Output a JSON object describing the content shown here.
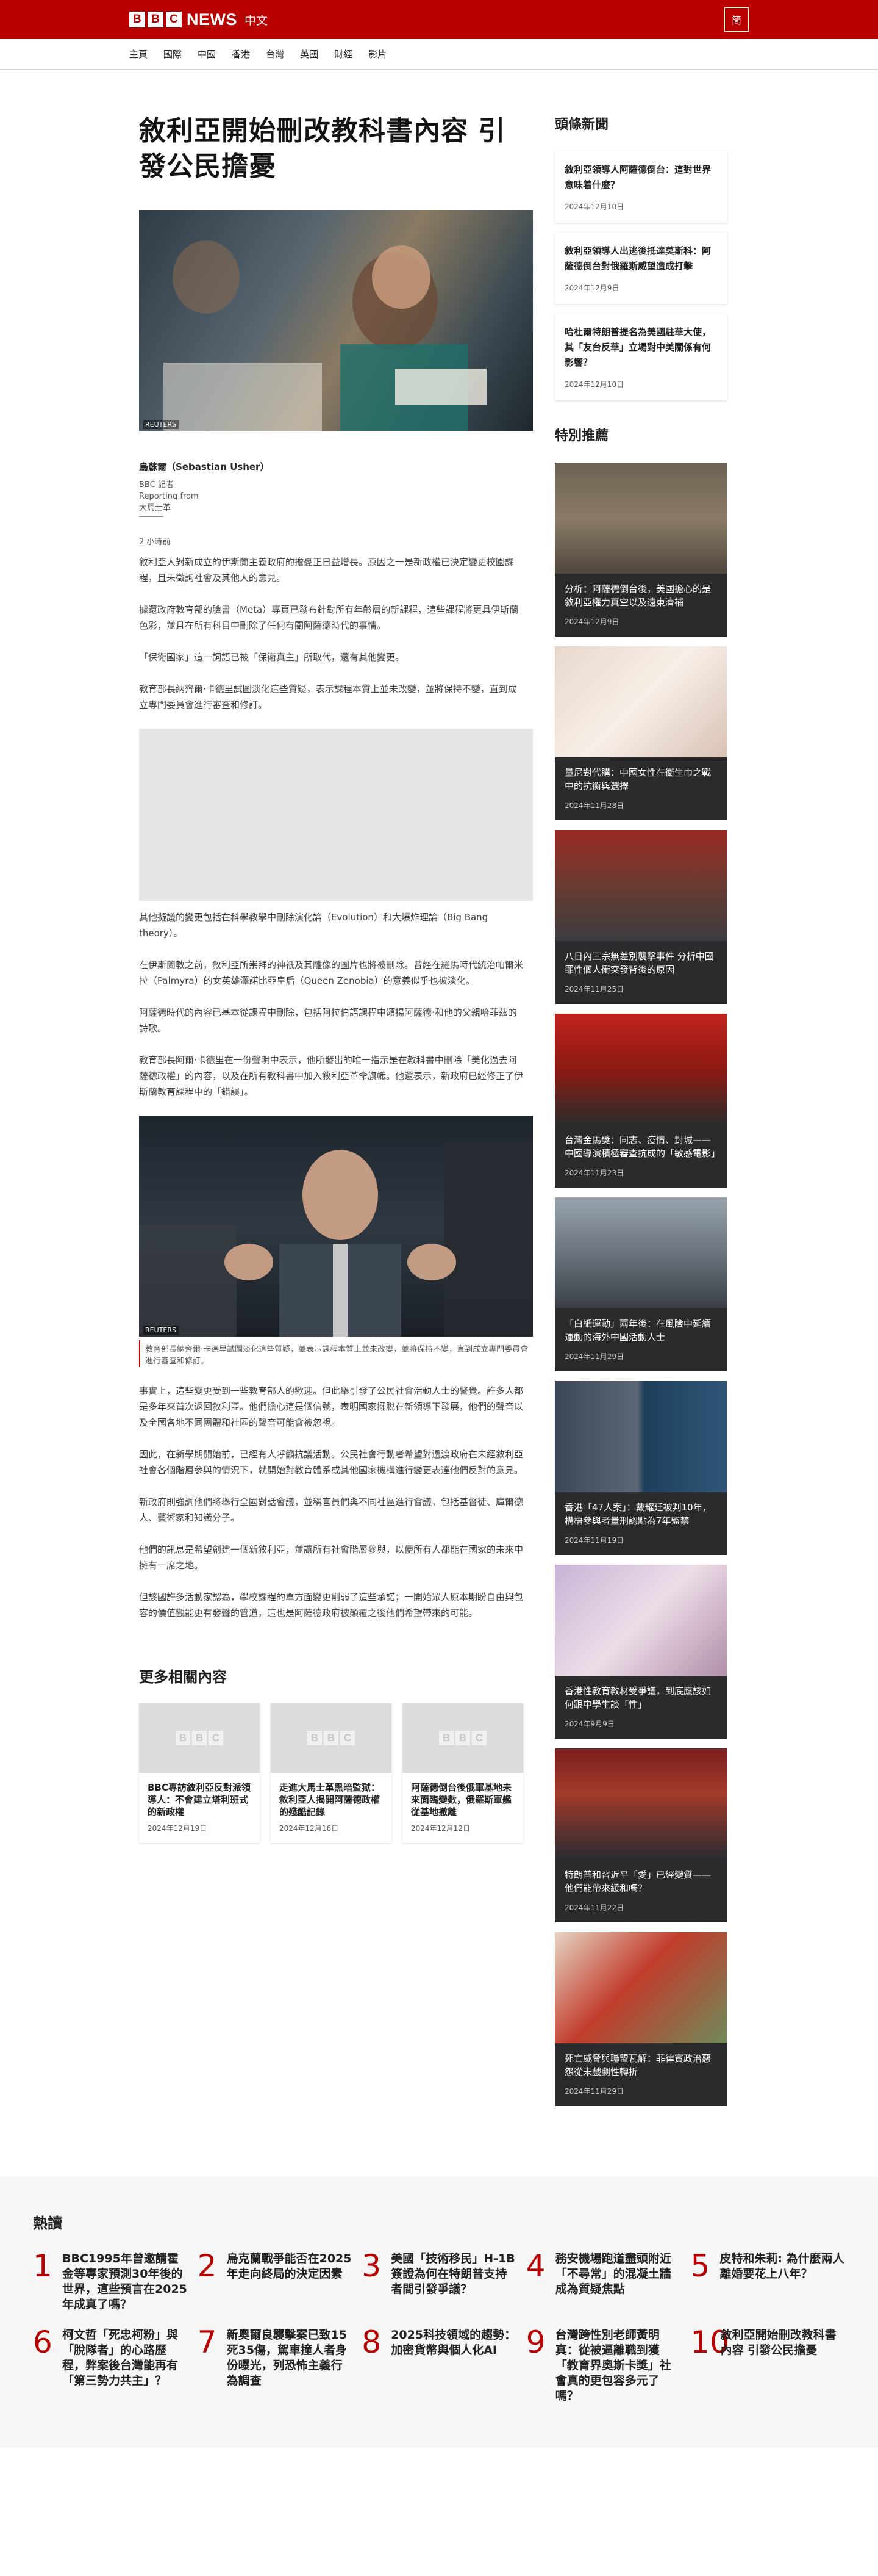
{
  "header": {
    "logo_letters": [
      "B",
      "B",
      "C"
    ],
    "news_word": "NEWS",
    "language": "中文",
    "script_toggle": "简"
  },
  "nav": {
    "items": [
      "主頁",
      "國際",
      "中國",
      "香港",
      "台灣",
      "英國",
      "財經",
      "影片"
    ]
  },
  "article": {
    "headline": "敘利亞開始刪改教科書內容 引發公民擔憂",
    "hero_credit": "REUTERS",
    "author_name": "烏蘇爾（Sebastian Usher）",
    "author_role1": "BBC 記者",
    "author_role2": "Reporting from",
    "author_location": "大馬士革",
    "timestamp": "2 小時前",
    "paragraphs_a": [
      "敘利亞人對新成立的伊斯蘭主義政府的擔憂正日益增長。原因之一是新政權已決定變更校園課程，且未徵詢社會及其他人的意見。",
      "據還政府教育部的臉書（Meta）專頁已發布針對所有年齡層的新課程，這些課程將更具伊斯蘭色彩，並且在所有科目中刪除了任何有關阿薩德時代的事情。",
      "「保衛國家」這一詞語已被「保衛真主」所取代，還有其他變更。",
      "教育部長納齊爾·卡德里試圖淡化這些質疑，表示課程本質上並未改變，並將保持不變，直到成立專門委員會進行審查和修訂。"
    ],
    "paragraphs_b": [
      "其他擬議的變更包括在科學教學中刪除演化論（Evolution）和大爆炸理論（Big Bang theory）。",
      "在伊斯蘭教之前，敘利亞所崇拜的神祇及其雕像的圖片也將被刪除。曾經在羅馬時代統治帕爾米拉（Palmyra）的女英雄澤諾比亞皇后（Queen Zenobia）的意義似乎也被淡化。",
      "阿薩德時代的內容已基本從課程中刪除，包括阿拉伯語課程中頌揚阿薩德·和他的父親哈菲茲的詩歌。",
      "教育部長阿爾·卡德里在一份聲明中表示，他所發出的唯一指示是在教科書中刪除「美化過去阿薩德政權」的內容，以及在所有教科書中加入敘利亞革命旗幟。他還表示，新政府已經修正了伊斯蘭教育課程中的「錯誤」。"
    ],
    "second_credit": "REUTERS",
    "second_caption": "教育部長納齊爾·卡德里試圖淡化這些質疑，並表示課程本質上並未改變，並將保持不變，直到成立專門委員會進行審查和修訂。",
    "paragraphs_c": [
      "事實上，這些變更受到一些教育部人的歡迎。但此舉引發了公民社會活動人士的警覺。許多人都是多年來首次返回敘利亞。他們擔心這是個信號，表明國家擺脫在新領導下發展，他們的聲音以及全國各地不同團體和社區的聲音可能會被忽視。",
      "因此，在新學期開始前，已經有人呼籲抗議活動。公民社會行動者希望對過渡政府在未經敘利亞社會各個階層參與的情況下，就開始對教育體系或其他國家機構進行變更表達他們反對的意見。",
      "新政府則強調他們將舉行全國對話會議，並稱官員們與不同社區進行會議，包括基督徒、庫爾德人、藝術家和知識分子。",
      "他們的訊息是希望創建一個新敘利亞，並讓所有社會階層參與，以便所有人都能在國家的未來中擁有一席之地。",
      "但該國許多活動家認為，學校課程的單方面變更削弱了這些承諾；一開始眾人原本期盼自由與包容的價值觀能更有發聲的管道，這也是阿薩德政府被顛覆之後他們希望帶來的可能。"
    ]
  },
  "related": {
    "title": "更多相關內容",
    "cards": [
      {
        "headline": "BBC專訪敘利亞反對派領導人：不會建立塔利班式的新政權",
        "date": "2024年12月19日"
      },
      {
        "headline": "走進大馬士革黑暗監獄：敘利亞人揭開阿薩德政權的殘酷記錄",
        "date": "2024年12月16日"
      },
      {
        "headline": "阿薩德倒台後俄軍基地未來面臨變數，俄羅斯軍艦從基地撤離",
        "date": "2024年12月12日"
      }
    ]
  },
  "sidebar": {
    "top_title": "頭條新聞",
    "top_stories": [
      {
        "headline": "敘利亞領導人阿薩德倒台：這對世界意味着什麼？",
        "date": "2024年12月10日"
      },
      {
        "headline": "敘利亞領導人出逃後抵達莫斯科：阿薩德倒台對俄羅斯威望造成打擊",
        "date": "2024年12月9日"
      },
      {
        "headline": "哈杜爾特朗普提名為美國駐華大使，其「友台反華」立場對中美關係有何影響？",
        "date": "2024年12月10日"
      }
    ],
    "featured_title": "特別推薦",
    "featured": [
      {
        "headline": "分析：阿薩德倒台後，美國擔心的是敘利亞權力真空以及遠東濟補",
        "date": "2024年12月9日"
      },
      {
        "headline": "量尼對代購：中國女性在衛生巾之戰中的抗衡與選擇",
        "date": "2024年11月28日"
      },
      {
        "headline": "八日內三宗無差別襲擊事件 分析中國罪性個人衝突發背後的原因",
        "date": "2024年11月25日"
      },
      {
        "headline": "台灣金馬獎：同志、疫情、封城——中國導演積極審查抗成的「敏感電影」",
        "date": "2024年11月23日"
      },
      {
        "headline": "「白紙運動」兩年後：在風險中延續運動的海外中國活動人士",
        "date": "2024年11月29日"
      },
      {
        "headline": "香港「47人案」：戴耀廷被判10年，構梧參與者量刑認點為7年監禁",
        "date": "2024年11月19日"
      },
      {
        "headline": "香港性教育教材受爭議，到底應該如何跟中學生談「性」",
        "date": "2024年9月9日"
      },
      {
        "headline": "特朗普和習近平「愛」已經變質——他們能帶來緩和嗎？",
        "date": "2024年11月22日"
      },
      {
        "headline": "死亡威脅與聯盟瓦解：菲律賓政治惡怨從未戲劇性轉折",
        "date": "2024年11月29日"
      }
    ]
  },
  "most_read": {
    "title": "熱讀",
    "items": [
      {
        "num": "1",
        "headline": "BBC1995年曾邀請霍金等專家預測30年後的世界，這些預言在2025年成真了嗎？"
      },
      {
        "num": "2",
        "headline": "烏克蘭戰爭能否在2025年走向終局的決定因素"
      },
      {
        "num": "3",
        "headline": "美國「技術移民」H-1B簽證為何在特朗普支持者間引發爭議？"
      },
      {
        "num": "4",
        "headline": "務安機場跑道盡頭附近「不尋常」的混凝土牆成為質疑焦點"
      },
      {
        "num": "5",
        "headline": "皮特和朱莉: 為什麼兩人離婚要花上八年？"
      },
      {
        "num": "6",
        "headline": "柯文哲「死忠柯粉」與「脫隊者」的心路歷程，弊案後台灣能再有「第三勢力共主」？"
      },
      {
        "num": "7",
        "headline": "新奧爾良襲擊案已致15死35傷，駕車撞人者身份曝光，列恐怖主義行為調查"
      },
      {
        "num": "8",
        "headline": "2025科技領域的趨勢：加密貨幣與個人化AI"
      },
      {
        "num": "9",
        "headline": "台灣跨性別老師黃明真：從被逼離職到獲「教育界奧斯卡獎」社會真的更包容多元了嗎？"
      },
      {
        "num": "10",
        "headline": "敘利亞開始刪改教科書內容 引發公民擔憂"
      }
    ]
  },
  "colors": {
    "brand_red": "#b80000",
    "dark_card": "#2b2b2e"
  }
}
